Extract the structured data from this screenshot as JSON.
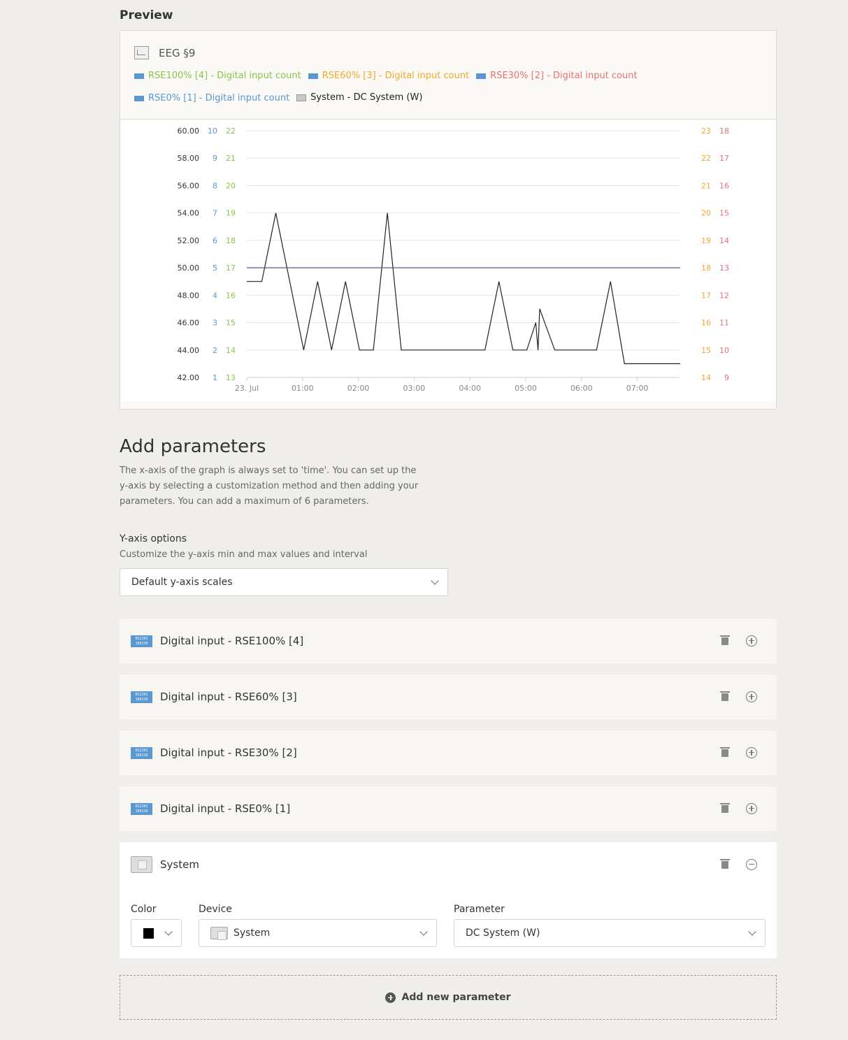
{
  "preview": {
    "title": "Preview"
  },
  "chart_header": {
    "title": "EEG §9",
    "legend": [
      {
        "label": "RSE100% [4]  - Digital input count",
        "color": "#8bc34a",
        "icon": "digital-input-icon"
      },
      {
        "label": "RSE60% [3]  - Digital input count",
        "color": "#f0a830",
        "icon": "digital-input-icon"
      },
      {
        "label": "RSE30% [2]  - Digital input count",
        "color": "#e57373",
        "icon": "digital-input-icon"
      },
      {
        "label": "RSE0% [1]  - Digital input count",
        "color": "#5b97d1",
        "icon": "digital-input-icon"
      },
      {
        "label": "System  - DC System (W)",
        "color": "#222222",
        "icon": "system-device-icon"
      }
    ]
  },
  "chart_data": {
    "type": "line",
    "x_tick_labels": [
      "23. Jul",
      "01:00",
      "02:00",
      "03:00",
      "04:00",
      "05:00",
      "06:00",
      "07:00"
    ],
    "y_axes": [
      {
        "side": "left",
        "color": "#333333",
        "ticks": [
          "60.00",
          "58.00",
          "56.00",
          "54.00",
          "52.00",
          "50.00",
          "48.00",
          "46.00",
          "44.00",
          "42.00"
        ],
        "range": [
          42,
          60
        ]
      },
      {
        "side": "left",
        "color": "#5b97d1",
        "ticks": [
          "10",
          "9",
          "8",
          "7",
          "6",
          "5",
          "4",
          "3",
          "2",
          "1"
        ],
        "range": [
          1,
          10
        ]
      },
      {
        "side": "left",
        "color": "#8bc34a",
        "ticks": [
          "22",
          "21",
          "20",
          "19",
          "18",
          "17",
          "16",
          "15",
          "14",
          "13"
        ],
        "range": [
          13,
          22
        ]
      },
      {
        "side": "right",
        "color": "#f0a830",
        "ticks": [
          "23",
          "22",
          "21",
          "20",
          "19",
          "18",
          "17",
          "16",
          "15",
          "14"
        ],
        "range": [
          14,
          23
        ]
      },
      {
        "side": "right",
        "color": "#e57373",
        "ticks": [
          "18",
          "17",
          "16",
          "15",
          "14",
          "13",
          "12",
          "11",
          "10",
          "9"
        ],
        "range": [
          9,
          18
        ]
      }
    ],
    "series": [
      {
        "color": "#222222",
        "x_hours": [
          0,
          0.27,
          0.52,
          1.02,
          1.27,
          1.52,
          1.77,
          2.02,
          2.27,
          2.52,
          2.77,
          3.02,
          3.52,
          4.02,
          4.27,
          4.52,
          4.77,
          5.02,
          5.18,
          5.22,
          5.25,
          5.52,
          6.02,
          6.27,
          6.52,
          6.77,
          7.02,
          7.52,
          7.77
        ],
        "values": [
          49,
          49,
          54,
          44,
          49,
          44,
          49,
          44,
          44,
          54,
          44,
          44,
          44,
          44,
          44,
          49,
          44,
          44,
          46,
          44,
          47,
          44,
          44,
          44,
          49,
          43,
          43,
          43,
          43
        ]
      },
      {
        "color": "#5a5a78",
        "x_hours": [
          0,
          7.77
        ],
        "values": [
          50,
          50
        ]
      }
    ],
    "grid": true
  },
  "add_parameters": {
    "title": "Add parameters",
    "description": "The x-axis of the graph is always set to 'time'. You can set up the y-axis by selecting a customization method and then adding your parameters. You can add a maximum of 6 parameters."
  },
  "y_axis_options": {
    "label": "Y-axis options",
    "help": "Customize the y-axis min and max values and interval",
    "selected": "Default y-axis scales"
  },
  "parameters": [
    {
      "name": "Digital input - RSE100% [4]"
    },
    {
      "name": "Digital input - RSE60% [3]"
    },
    {
      "name": "Digital input - RSE30% [2]"
    },
    {
      "name": "Digital input - RSE0% [1]"
    }
  ],
  "system_param": {
    "name": "System",
    "color_label": "Color",
    "color_value": "#000000",
    "device_label": "Device",
    "device_value": "System",
    "parameter_label": "Parameter",
    "parameter_value": "DC System (W)"
  },
  "add_new": {
    "label": "Add new parameter"
  }
}
